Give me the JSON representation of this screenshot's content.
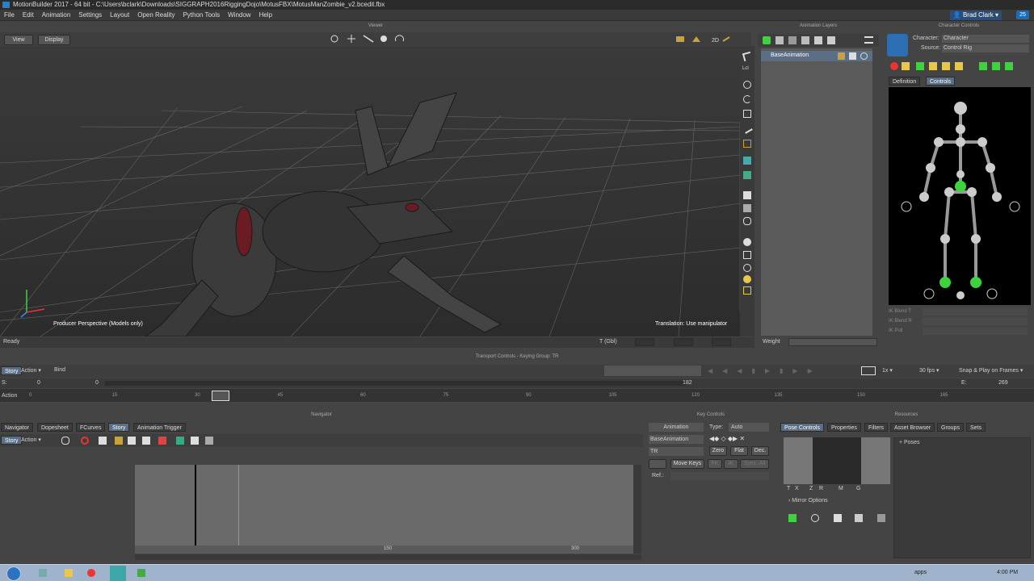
{
  "app": {
    "title": "MotionBuilder 2017  - 64 bit  - C:\\Users\\bclark\\Downloads\\SIGGRAPH2016RiggingDojo\\MotusFBX\\MotusManZombie_v2.bcedit.fbx",
    "user": "Brad Clark",
    "notifications": "25"
  },
  "menu": [
    "File",
    "Edit",
    "Animation",
    "Settings",
    "Layout",
    "Open Reality",
    "Python Tools",
    "Window",
    "Help"
  ],
  "viewer": {
    "title": "Viewer",
    "view_label": "View",
    "display_label": "Display",
    "camera_label": "Producer Perspective (Models only)",
    "manip_label": "Translation: Use manipulator",
    "status": "Ready",
    "gbl": "T (Gbl)",
    "lcl": "Lcl"
  },
  "anim_layers": {
    "title": "Animation Layers",
    "layer": "BaseAnimation",
    "weight_label": "Weight"
  },
  "char_controls": {
    "title": "Character Controls",
    "character_label": "Character:",
    "character_value": "Character",
    "source_label": "Source:",
    "source_value": "Control Rig",
    "tab_definition": "Definition",
    "tab_controls": "Controls",
    "ik_blend_t": "IK Blend T",
    "ik_blend_r": "IK Blend R",
    "ik_pull": "IK Pull"
  },
  "transport": {
    "title": "Transport Controls - Keying Group: TR",
    "tab_story": "Story",
    "tab_action": "Action",
    "bind": "Bind",
    "speed": "1x",
    "fps": "30 fps",
    "snap": "Snap & Play on Frames",
    "start_label": "S:",
    "start_val": "0",
    "start_val2": "0",
    "end_label": "E:",
    "end_val": "269",
    "current": "182",
    "action_label": "Action",
    "ticks": [
      "0",
      "15",
      "30",
      "45",
      "60",
      "75",
      "90",
      "105",
      "120",
      "135",
      "150",
      "165"
    ]
  },
  "navigator": {
    "title": "Navigator",
    "tabs": [
      "Navigator",
      "Dopesheet",
      "FCurves",
      "Story",
      "Animation Trigger"
    ],
    "active": "Story",
    "story": "Story",
    "action": "Action",
    "story_ticks": [
      "150",
      "300"
    ]
  },
  "key_controls": {
    "title": "Key Controls",
    "animation": "Animation",
    "type_label": "Type:",
    "type_value": "Auto",
    "layer": "BaseAnimation",
    "group": "TR",
    "zero": "Zero",
    "flat": "Flat",
    "dec": "Dec.",
    "move_keys": "Move Keys",
    "fk": "FK",
    "ik": "IK",
    "sync_all": "Sync. All",
    "ref_label": "Ref.:"
  },
  "resources": {
    "title": "Resources",
    "tabs": [
      "Pose Controls",
      "Properties",
      "Filters",
      "Asset Browser",
      "Groups",
      "Sets"
    ],
    "active": "Pose Controls",
    "tree_item": "Poses",
    "pose_labels": [
      "T",
      "X",
      "Z",
      "R",
      "M",
      "G"
    ],
    "mirror": "Mirror Options"
  },
  "taskbar": {
    "apps_label": "apps",
    "time": "4:00 PM"
  },
  "colors": {
    "accent": "#5a6e86",
    "green": "#3ed33e",
    "bg": "#444444"
  }
}
